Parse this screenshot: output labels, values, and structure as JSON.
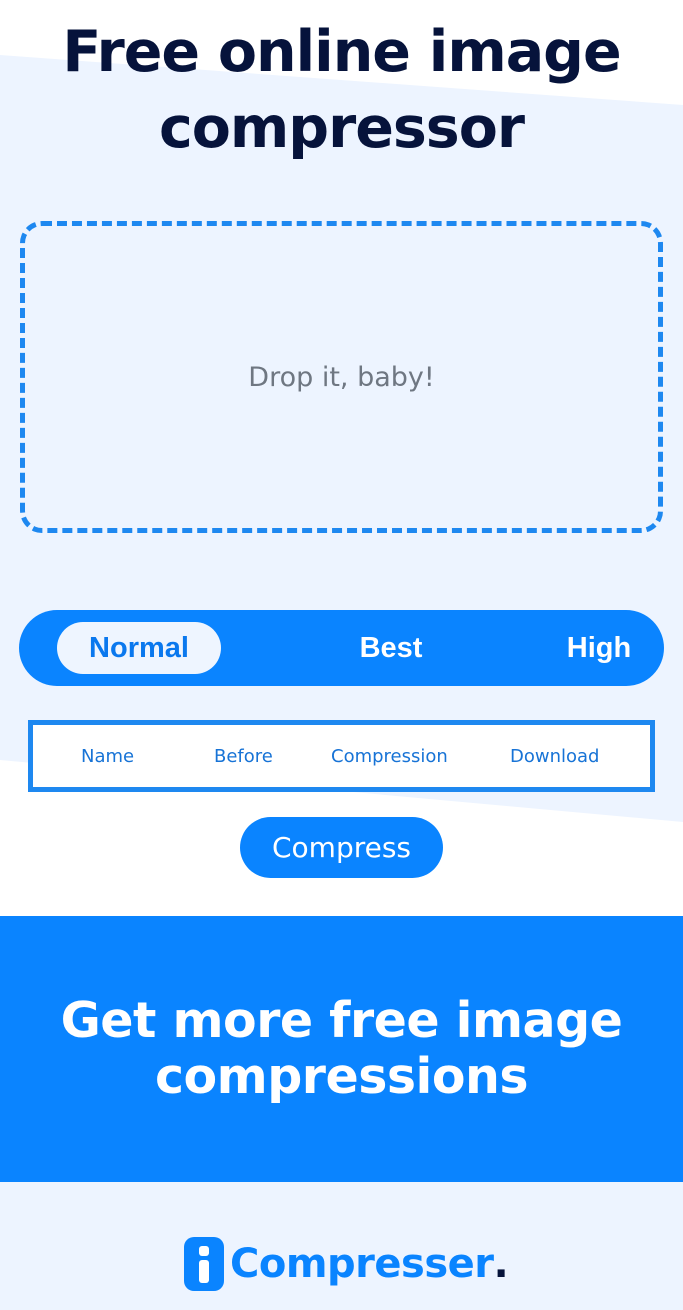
{
  "hero": {
    "title": "Free online image compressor",
    "dropzone_text": "Drop it, baby!"
  },
  "quality_selector": {
    "options": [
      {
        "label": "Normal",
        "selected": true
      },
      {
        "label": "Best",
        "selected": false
      },
      {
        "label": "High",
        "selected": false
      }
    ]
  },
  "results_table": {
    "columns": [
      "Name",
      "Before",
      "Compression",
      "Download"
    ]
  },
  "compress_button": {
    "label": "Compress"
  },
  "banner": {
    "text": "Get more free image compressions"
  },
  "footer": {
    "logo_icon": "i-letter-icon",
    "logo_text": "Compresser",
    "logo_punct": "."
  },
  "colors": {
    "accent": "#0a84ff",
    "title_navy": "#06133b",
    "light_bg": "#edf4ff"
  }
}
